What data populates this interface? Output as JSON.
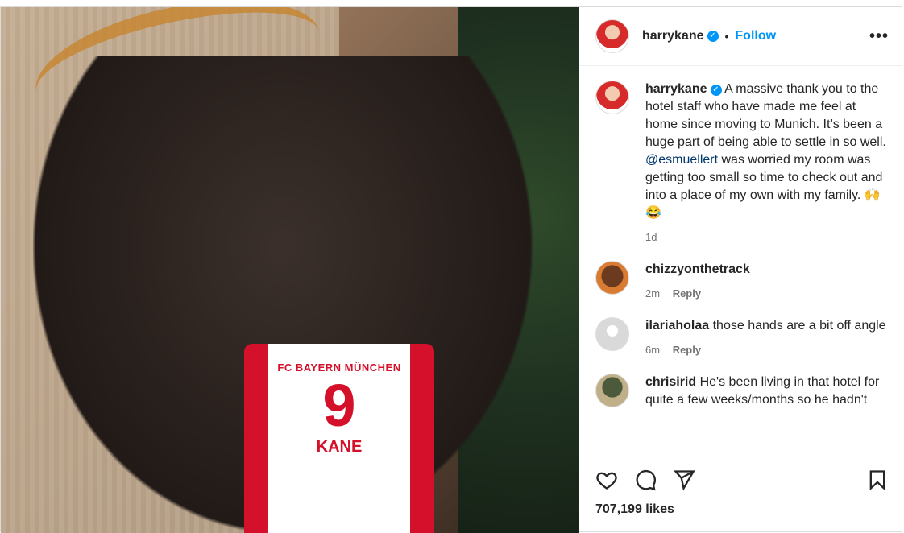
{
  "post": {
    "author": "harrykane",
    "follow_label": "Follow",
    "more_label": "•••",
    "jersey": {
      "club": "FC BAYERN MÜNCHEN",
      "number": "9",
      "name": "KANE"
    }
  },
  "caption": {
    "author": "harrykane",
    "text_before": " A massive thank you to the hotel staff who have made me feel at home since moving to Munich. It’s been a huge part of being able to settle in so well. ",
    "mention": "@esmuellert",
    "text_after": " was worried my room was getting too small so time to check out and into a place of my own with my family. 🙌 😂",
    "time": "1d"
  },
  "comments": [
    {
      "user": "chizzyonthetrack",
      "text": "",
      "time": "2m",
      "reply": "Reply"
    },
    {
      "user": "ilariaholaa",
      "text": " those hands are a bit off angle",
      "time": "6m",
      "reply": "Reply"
    },
    {
      "user": "chrisirid",
      "text": " He's been living in that hotel for quite a few weeks/months so he hadn't",
      "time": "",
      "reply": ""
    }
  ],
  "likes": "707,199 likes",
  "colors": {
    "accent": "#0095f6",
    "text": "#262626",
    "muted": "#737373"
  },
  "icons": [
    "verified-badge-icon",
    "heart-icon",
    "comment-icon",
    "share-icon",
    "bookmark-icon",
    "more-options-icon"
  ]
}
